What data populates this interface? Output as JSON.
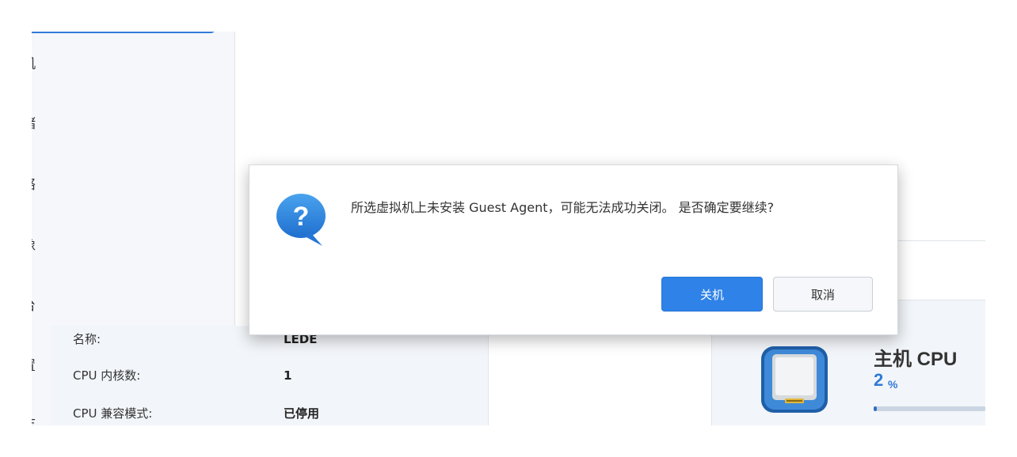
{
  "sidebar": {
    "items": [
      {
        "label": "机"
      },
      {
        "label": "储"
      },
      {
        "label": "络"
      },
      {
        "label": "像"
      },
      {
        "label": "台"
      },
      {
        "label": "置"
      },
      {
        "label": "志"
      }
    ]
  },
  "vm_info": {
    "rows": [
      {
        "label": "名称:",
        "value": "LEDE"
      },
      {
        "label": "CPU 内核数:",
        "value": "1"
      },
      {
        "label": "CPU 兼容模式:",
        "value": "已停用"
      }
    ]
  },
  "host_cpu": {
    "title": "主机 CPU",
    "value": "2",
    "unit": "%",
    "usage_fraction": 0.02
  },
  "dialog": {
    "icon": "question-bubble-icon",
    "message": "所选虚拟机上未安装 Guest Agent，可能无法成功关闭。 是否确定要继续?",
    "confirm_label": "关机",
    "cancel_label": "取消"
  },
  "colors": {
    "accent": "#2e82e8",
    "panel_bg": "#f2f5f9"
  }
}
